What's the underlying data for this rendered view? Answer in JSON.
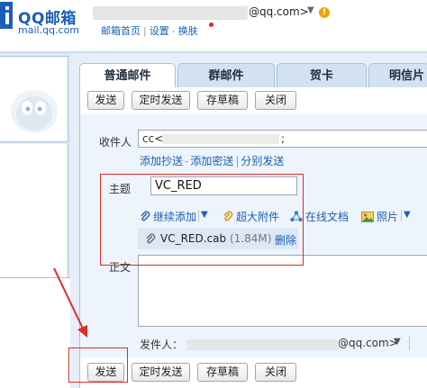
{
  "header": {
    "logo_title": "QQ邮箱",
    "logo_subtitle": "mail.qq.com",
    "account_domain": "@qq.com>",
    "account_menu_caret": "▼",
    "warn_mark": "!",
    "nav": [
      "邮箱首页",
      "设置",
      "换肤"
    ],
    "nav_separator": "|",
    "nav_dash": "-"
  },
  "tabs": [
    {
      "label": "普通邮件",
      "active": true
    },
    {
      "label": "群邮件",
      "active": false
    },
    {
      "label": "贺卡",
      "active": false
    },
    {
      "label": "明信片",
      "active": false
    }
  ],
  "toolbar": {
    "send": "发送",
    "scheduled_send": "定时发送",
    "save_draft": "存草稿",
    "close": "关闭"
  },
  "form": {
    "to_label": "收件人",
    "to_prefix": "cc<",
    "to_suffix": ";",
    "recipient_links": [
      "添加抄送",
      "添加密送",
      "分别发送"
    ],
    "link_dash": "-",
    "link_sep": "|",
    "subject_label": "主题",
    "subject_value": "VC_RED",
    "tools": {
      "continue_add": "继续添加",
      "large_attachment": "超大附件",
      "online_docs": "在线文档",
      "photos": "照片"
    },
    "attachment": {
      "name": "VC_RED.cab",
      "size": "(1.84M)",
      "delete": "删除"
    },
    "body_label": "正文",
    "sender_label": "发件人：",
    "sender_suffix": "@qq.com>",
    "sender_caret": "▼"
  },
  "colors": {
    "brand": "#1a5fb4",
    "annotation": "#e02a2a",
    "panel": "#e6eff9",
    "warning": "#f0a30a"
  },
  "icons": [
    "qq-mail-logo-icon",
    "warning-icon",
    "qq-penguin-icon",
    "paperclip-icon",
    "paperclip-gold-icon",
    "online-doc-icon",
    "photo-icon",
    "dropdown-arrow-icon",
    "red-arrow-annotation"
  ]
}
